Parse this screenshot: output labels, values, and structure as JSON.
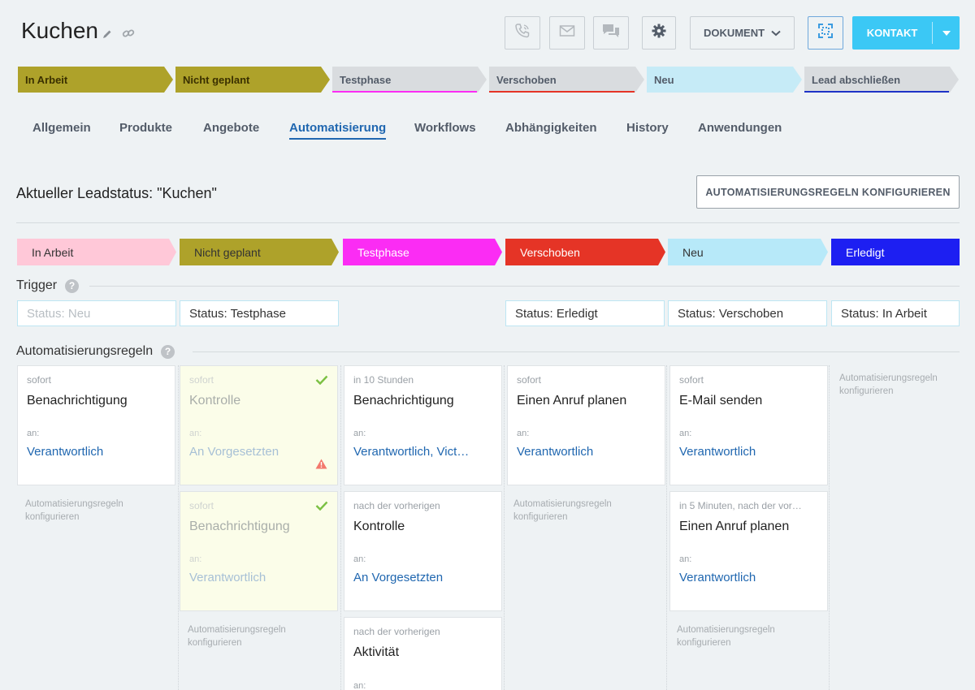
{
  "header": {
    "title": "Kuchen",
    "document_label": "DOKUMENT",
    "contact_label": "KONTAKT"
  },
  "top_stages": [
    {
      "label": "In Arbeit",
      "bg": "#aea22a",
      "line": ""
    },
    {
      "label": "Nicht geplant",
      "bg": "#aea22a",
      "line": ""
    },
    {
      "label": "Testphase",
      "bg": "#d9dcdf",
      "line": "#fb2cf4"
    },
    {
      "label": "Verschoben",
      "bg": "#d9dcdf",
      "line": "#e53426"
    },
    {
      "label": "Neu",
      "bg": "#c6ebf7",
      "line": ""
    },
    {
      "label": "Lead abschließen",
      "bg": "#d9dcdf",
      "line": "#1d32c7"
    }
  ],
  "tabs": [
    "Allgemein",
    "Produkte",
    "Angebote",
    "Automatisierung",
    "Workflows",
    "Abhängigkeiten",
    "History",
    "Anwendungen"
  ],
  "active_tab": "Automatisierung",
  "main": {
    "lead_status": "Aktueller Leadstatus: \"Kuchen\"",
    "config_button": "AUTOMATISIERUNGSREGELN KONFIGURIEREN",
    "trigger_label": "Trigger",
    "rules_label": "Automatisierungsregeln"
  },
  "status_stages": [
    {
      "label": "In Arbeit",
      "bg": "#ffc8d8",
      "color": "#333333"
    },
    {
      "label": "Nicht geplant",
      "bg": "#aea22a",
      "color": "#333333"
    },
    {
      "label": "Testphase",
      "bg": "#fb2cf4",
      "color": "#ffffff"
    },
    {
      "label": "Verschoben",
      "bg": "#e53426",
      "color": "#ffffff"
    },
    {
      "label": "Neu",
      "bg": "#b7e9f9",
      "color": "#333333"
    },
    {
      "label": "Erledigt",
      "bg": "#1d1ff2",
      "color": "#ffffff"
    }
  ],
  "triggers": [
    {
      "text": "Status: Neu",
      "placeholder": true
    },
    {
      "text": "Status: Testphase",
      "placeholder": false
    },
    {
      "text": "Status: Erledigt",
      "placeholder": false
    },
    {
      "text": "Status: Verschoben",
      "placeholder": false
    },
    {
      "text": "Status: In Arbeit",
      "placeholder": false
    }
  ],
  "cards": {
    "c1": {
      "timing": "sofort",
      "action": "Benachrichtigung",
      "an": "an:",
      "target": "Verantwortlich"
    },
    "c2": {
      "timing": "sofort",
      "action": "Kontrolle",
      "an": "an:",
      "target": "An Vorgesetzten"
    },
    "c3": {
      "timing": "sofort",
      "action": "Benachrichtigung",
      "an": "an:",
      "target": "Verantwortlich"
    },
    "c4": {
      "timing": "in 10 Stunden",
      "action": "Benachrichtigung",
      "an": "an:",
      "target": "Verantwortlich, Vict…"
    },
    "c5": {
      "timing": "nach der vorherigen",
      "action": "Kontrolle",
      "an": "an:",
      "target": "An Vorgesetzten"
    },
    "c6": {
      "timing": "nach der vorherigen",
      "action": "Aktivität",
      "an": "an:",
      "target": ""
    },
    "c7": {
      "timing": "sofort",
      "action": "Einen Anruf planen",
      "an": "an:",
      "target": "Verantwortlich"
    },
    "c8": {
      "timing": "sofort",
      "action": "E-Mail senden",
      "an": "an:",
      "target": "Verantwortlich"
    },
    "c9": {
      "timing": "in 5 Minuten, nach der vor…",
      "action": "Einen Anruf planen",
      "an": "an:",
      "target": "Verantwortlich"
    }
  },
  "configure_link": "Automatisierungsregeln konfigurieren",
  "icons": [
    "pencil-icon",
    "link-icon",
    "phone-icon",
    "mail-icon",
    "chat-icon",
    "gear-icon",
    "chevron-down-icon",
    "expand-icon",
    "check-icon",
    "warning-icon",
    "help-icon"
  ]
}
